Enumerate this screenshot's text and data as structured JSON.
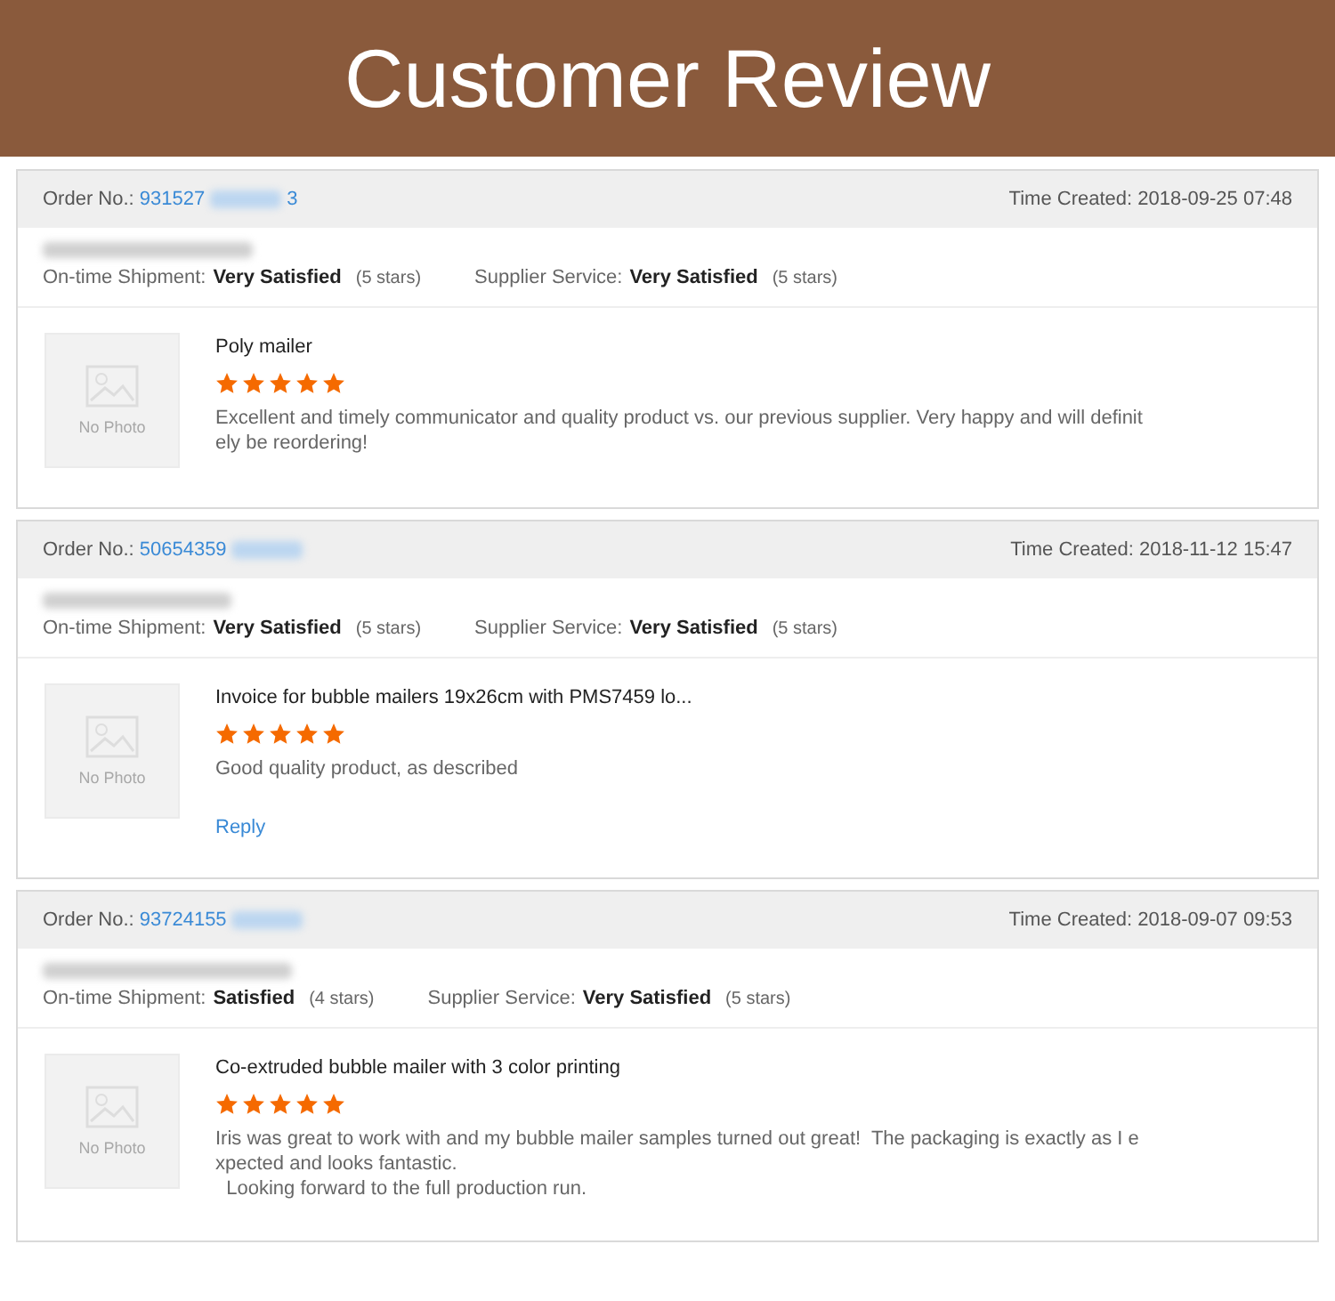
{
  "banner": {
    "title": "Customer Review"
  },
  "reviews": [
    {
      "order_label": "Order No.:",
      "order_number": "931527",
      "order_suffix": "3",
      "time_created": "Time Created: 2018-09-25 07:48",
      "ratings": [
        {
          "label": "On-time Shipment:",
          "value": "Very Satisfied",
          "stars_text": "(5 stars)"
        },
        {
          "label": "Supplier Service:",
          "value": "Very Satisfied",
          "stars_text": "(5 stars)"
        }
      ],
      "photo_text": "No Photo",
      "product": "Poly mailer",
      "stars": 5,
      "text_lines": [
        "Excellent and timely communicator and quality product vs. our previous supplier. Very happy and will definit",
        "ely be reordering!"
      ]
    },
    {
      "order_label": "Order No.:",
      "order_number": "50654359",
      "time_created": "Time Created: 2018-11-12 15:47",
      "ratings": [
        {
          "label": "On-time Shipment:",
          "value": "Very Satisfied",
          "stars_text": "(5 stars)"
        },
        {
          "label": "Supplier Service:",
          "value": "Very Satisfied",
          "stars_text": "(5 stars)"
        }
      ],
      "photo_text": "No Photo",
      "product": "Invoice for bubble mailers 19x26cm with PMS7459 lo...",
      "stars": 5,
      "text_lines": [
        "Good quality product, as described"
      ],
      "reply": "Reply"
    },
    {
      "order_label": "Order No.:",
      "order_number": "93724155",
      "time_created": "Time Created: 2018-09-07 09:53",
      "ratings": [
        {
          "label": "On-time Shipment:",
          "value": "Satisfied",
          "stars_text": "(4 stars)"
        },
        {
          "label": "Supplier Service:",
          "value": "Very Satisfied",
          "stars_text": "(5 stars)"
        }
      ],
      "photo_text": "No Photo",
      "product": "Co-extruded bubble mailer with 3 color printing",
      "stars": 5,
      "text_lines": [
        "Iris was great to work with and my bubble mailer samples turned out great!  The packaging is exactly as I e",
        "xpected and looks fantastic.",
        "  Looking forward to the full production run."
      ]
    }
  ]
}
